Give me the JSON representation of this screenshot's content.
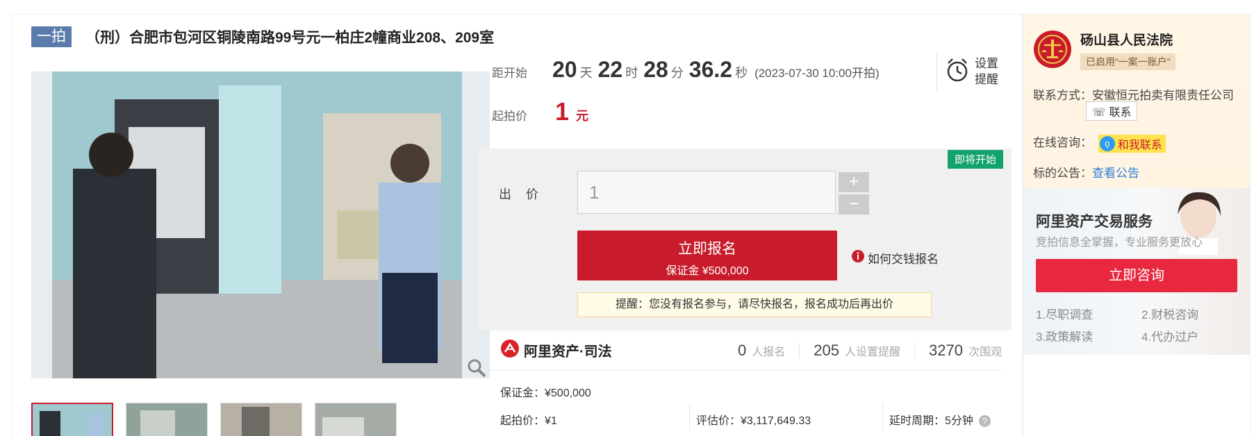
{
  "title": {
    "round_tag": "一拍",
    "text": "（刑）合肥市包河区铜陵南路99号元一柏庄2幢商业208、209室"
  },
  "countdown": {
    "label": "距开始",
    "days": "20",
    "days_unit": "天",
    "hours": "22",
    "hours_unit": "时",
    "minutes": "28",
    "minutes_unit": "分",
    "seconds": "36.2",
    "seconds_unit": "秒",
    "start_note": "(2023-07-30 10:00开拍)"
  },
  "remind": {
    "line1": "设置",
    "line2": "提醒"
  },
  "start_price": {
    "label": "起拍价",
    "value": "1",
    "unit": "元"
  },
  "bid": {
    "soon_badge": "即将开始",
    "label": "出 价",
    "input_value": "1",
    "plus": "+",
    "minus": "−",
    "signup_main": "立即报名",
    "signup_sub": "保证金 ¥500,000",
    "how_pay": "如何交钱报名",
    "warning": "提醒：您没有报名参与，请尽快报名，报名成功后再出价"
  },
  "brand": {
    "name": "阿里资产·司法"
  },
  "stats": [
    {
      "num": "0",
      "label": "人报名"
    },
    {
      "num": "205",
      "label": "人设置提醒"
    },
    {
      "num": "3270",
      "label": "次围观"
    }
  ],
  "facts": {
    "deposit": "保证金：¥500,000",
    "start_price": "起拍价：¥1",
    "appraisal": "评估价：¥3,117,649.33",
    "delay": "延时周期：5分钟"
  },
  "court": {
    "name": "砀山县人民法院",
    "tag": "已启用“一案一账户”",
    "contact_label": "联系方式：",
    "contact_value": "安徽恒元拍卖有限责任公司",
    "contact_btn": "联系",
    "consult_label": "在线咨询：",
    "consult_btn": "和我联系",
    "notice_label": "标的公告：",
    "notice_link": "查看公告"
  },
  "ad": {
    "title": "阿里资产交易服务",
    "subtitle": "竞拍信息全掌握，专业服务更放心",
    "button": "立即咨询",
    "items": [
      "1.尽职调查",
      "2.财税咨询",
      "3.政策解读",
      "4.代办过户"
    ]
  },
  "colors": {
    "accent_red": "#c81c2c",
    "badge_green": "#12a26e",
    "tag_blue": "#5b7baa",
    "link_blue": "#2d7fd8"
  }
}
